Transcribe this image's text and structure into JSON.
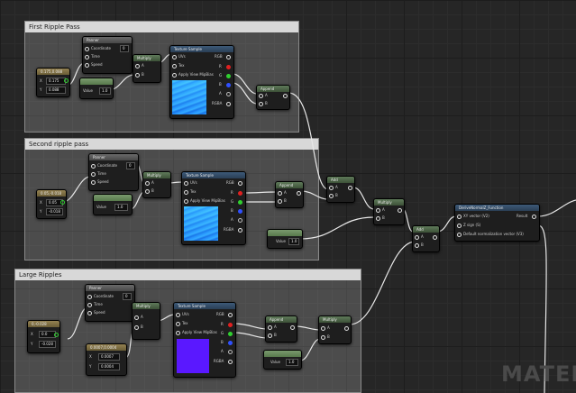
{
  "comments": {
    "first": "First Ripple Pass",
    "second": "Second ripple pass",
    "large": "Large Ripples"
  },
  "panner_node": {
    "title": "Panner",
    "coordinate": "Coordinate",
    "coordinate_value": "0",
    "time": "Time",
    "speed": "Speed"
  },
  "multiply_node": {
    "title": "Multiply",
    "a": "A",
    "b": "B"
  },
  "add_node": {
    "title": "Add",
    "a": "A",
    "b": "B"
  },
  "append_node": {
    "title": "Append",
    "a": "A",
    "b": "B"
  },
  "texture_sample": {
    "title": "Texture Sample",
    "uvs": "UVs",
    "tex": "Tex",
    "apply_mips": "Apply View MipBias",
    "rgb": "RGB",
    "r": "R",
    "g": "G",
    "b": "B",
    "a": "A",
    "rgba": "RGBA"
  },
  "first_pass": {
    "vec2_title": "0.175,0.088",
    "x_label": "X",
    "x_value": "0.175",
    "y_label": "Y",
    "y_value": "0.088",
    "scalar_label": "Value",
    "scalar_value": "1.0"
  },
  "second_pass": {
    "vec2_title": "0.05,-0.018",
    "x_label": "X",
    "x_value": "0.05",
    "y_label": "Y",
    "y_value": "-0.018",
    "scalar_label": "Value",
    "scalar_value": "1.0"
  },
  "large_pass": {
    "vec2_title": "0,-0.028",
    "x_label": "X",
    "x_value": "0.0",
    "y_label": "Y",
    "y_value": "-0.028",
    "vec2b_title": "0.0007,0.0004",
    "xb_label": "X",
    "xb_value": "0.0007",
    "yb_label": "Y",
    "yb_value": "0.0004",
    "scalar_label": "Value",
    "scalar_value": "1.0"
  },
  "mid_scalar": {
    "label": "Value",
    "value": "1.0"
  },
  "derive_node": {
    "title": "DeriveNormalZ_Function",
    "in1": "XY vector (V2)",
    "in2": "Z sign (S)",
    "in3": "Default normalization vector (V3)",
    "out": "Result"
  },
  "watermark": "MATER",
  "colors": {
    "pin_red": "#e02020",
    "pin_green": "#30d030",
    "pin_blue": "#3050ff",
    "texture_violet": "#5a18ff",
    "texture_ripple": "#2080ff"
  }
}
